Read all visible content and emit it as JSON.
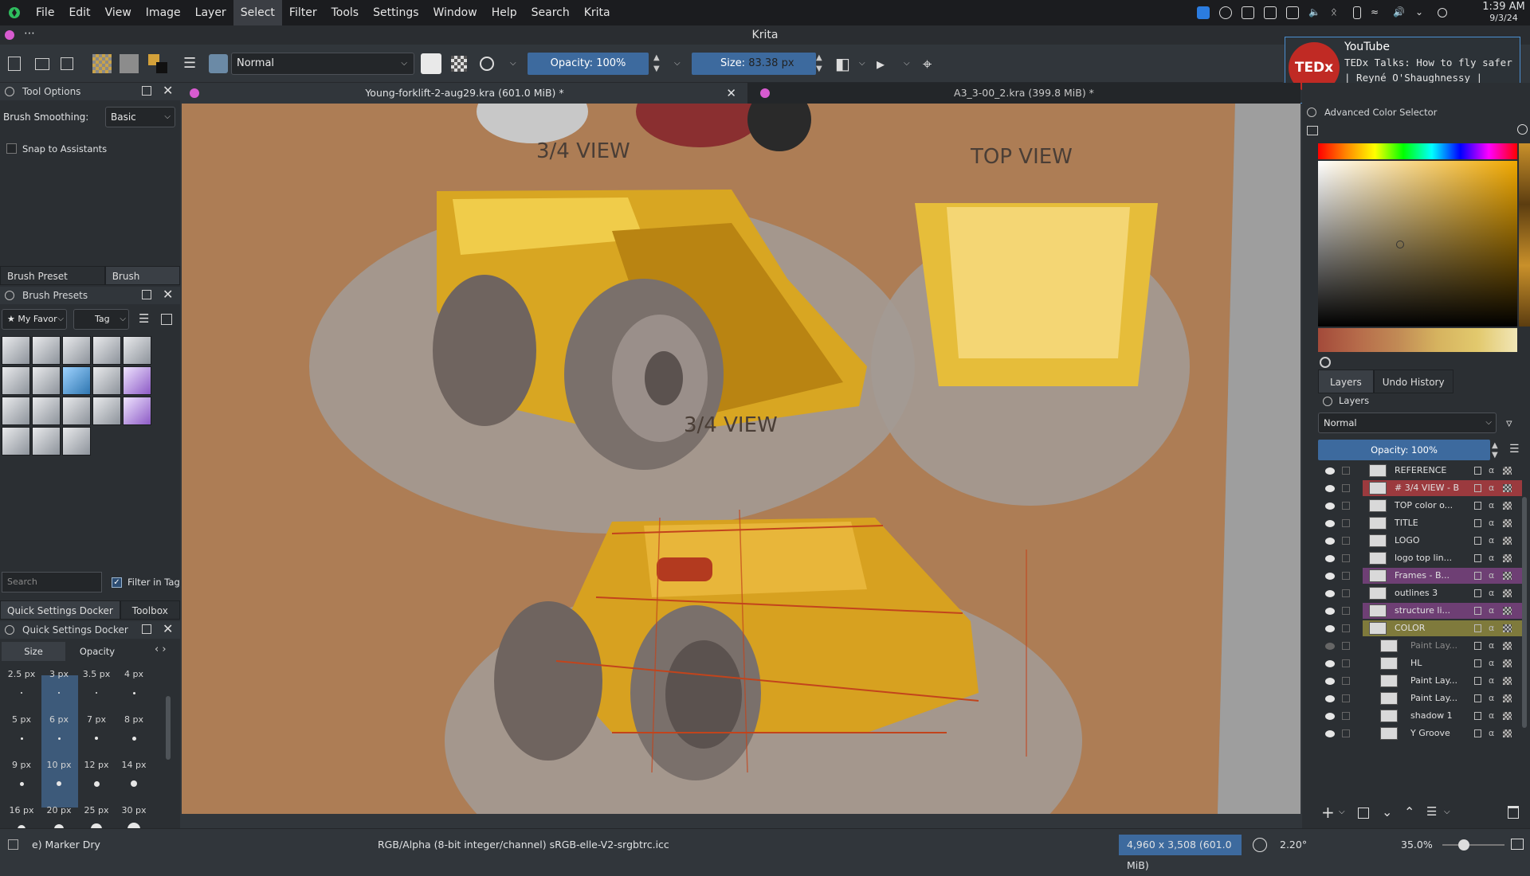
{
  "menubar": {
    "items": [
      "File",
      "Edit",
      "View",
      "Image",
      "Layer",
      "Select",
      "Filter",
      "Tools",
      "Settings",
      "Window",
      "Help",
      "Search",
      "Krita"
    ],
    "active": "Select",
    "clock_time": "1:39 AM",
    "clock_date": "9/3/24"
  },
  "window": {
    "title": "Krita"
  },
  "toolbar": {
    "blend_mode": "Normal",
    "opacity_label": "Opacity: 100%",
    "size_label": "Size:",
    "size_value": "83.38 px"
  },
  "tool_options": {
    "title": "Tool Options",
    "smoothing_label": "Brush Smoothing:",
    "smoothing_value": "Basic",
    "snap_label": "Snap to Assistants"
  },
  "brush_presets": {
    "tabs": [
      "Brush Preset History",
      "Brush Presets"
    ],
    "selected_tab": "Brush Presets",
    "title": "Brush Presets",
    "filter_value": "★ My Favor",
    "tag_label": "Tag",
    "search_placeholder": "Search",
    "filter_in_tag_label": "Filter in Tag"
  },
  "quick_settings": {
    "tabs": [
      "Quick Settings Docker",
      "Toolbox"
    ],
    "title": "Quick Settings Docker",
    "subtabs": [
      "Size",
      "Opacity"
    ],
    "sizes": [
      "2.5 px",
      "3 px",
      "3.5 px",
      "4 px",
      "5 px",
      "6 px",
      "7 px",
      "8 px",
      "9 px",
      "10 px",
      "12 px",
      "14 px",
      "16 px",
      "20 px",
      "25 px",
      "30 px"
    ],
    "selected": "6 px"
  },
  "documents": {
    "tabs": [
      {
        "label": "Young-forklift-2-aug29.kra (601.0 MiB) *"
      },
      {
        "label": "A3_3-00_2.kra (399.8 MiB) *"
      }
    ]
  },
  "canvas": {
    "annotations": [
      "3/4 VIEW",
      "TOP VIEW",
      "3/4 VIEW"
    ]
  },
  "youtube_popup": {
    "app": "YouTube",
    "logo": "TEDx",
    "text": "TEDx Talks: How to fly safer | Reyné O'Shaughnessy | TEDxYoung..."
  },
  "color_selector": {
    "title": "Advanced Color Selector"
  },
  "layers_panel": {
    "tabs": [
      "Layers",
      "Undo History"
    ],
    "title": "Layers",
    "blend_mode": "Normal",
    "opacity_label": "Opacity:  100%",
    "layers": [
      {
        "name": "REFERENCE",
        "color": ""
      },
      {
        "name": "# 3/4 VIEW - B",
        "color": "#9b3a3e"
      },
      {
        "name": "TOP color o...",
        "color": ""
      },
      {
        "name": "TITLE",
        "color": ""
      },
      {
        "name": "LOGO",
        "color": ""
      },
      {
        "name": "logo top lin...",
        "color": ""
      },
      {
        "name": "Frames - B...",
        "color": "#6e3f74"
      },
      {
        "name": "outlines 3",
        "color": ""
      },
      {
        "name": "structure li...",
        "color": "#6e3f74"
      },
      {
        "name": "COLOR",
        "color": "#7f7a3c"
      },
      {
        "name": "Paint Lay...",
        "color": ""
      },
      {
        "name": "HL",
        "color": ""
      },
      {
        "name": "Paint Lay...",
        "color": ""
      },
      {
        "name": "Paint Lay...",
        "color": ""
      },
      {
        "name": "shadow 1",
        "color": ""
      },
      {
        "name": "Y Groove",
        "color": ""
      }
    ]
  },
  "statusbar": {
    "brush_name": "e) Marker Dry",
    "color_profile": "RGB/Alpha (8-bit integer/channel)  sRGB-elle-V2-srgbtrc.icc",
    "image_size": "4,960 x 3,508 (601.0 MiB)",
    "rotation": "2.20°",
    "zoom": "35.0%"
  }
}
